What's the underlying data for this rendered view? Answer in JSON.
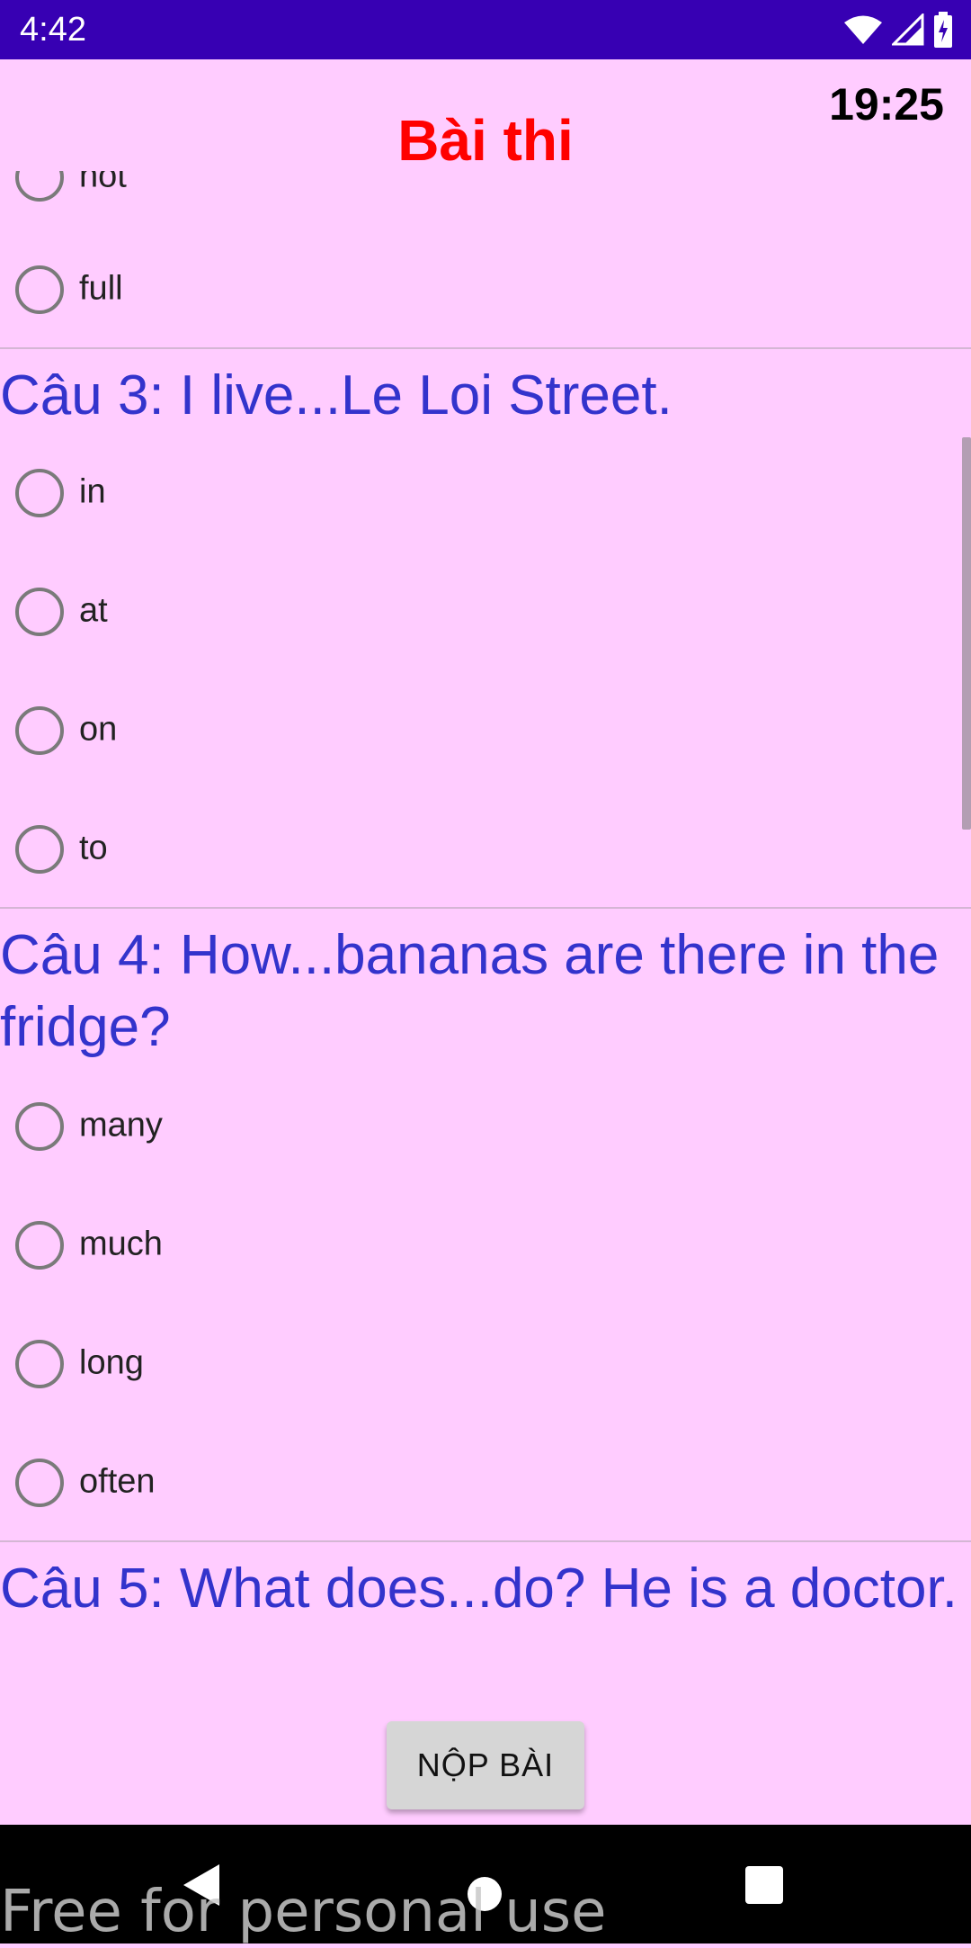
{
  "status_bar": {
    "time": "4:42"
  },
  "header": {
    "timer": "19:25",
    "title": "Bài thi"
  },
  "questions": [
    {
      "options": [
        "not",
        "full"
      ]
    },
    {
      "text": "Câu 3: I live...Le Loi Street.",
      "options": [
        "in",
        "at",
        "on",
        "to"
      ]
    },
    {
      "text": "Câu 4: How...bananas are there in the fridge?",
      "options": [
        "many",
        "much",
        "long",
        "often"
      ]
    },
    {
      "text": "Câu 5: What does...do? He is a doctor."
    }
  ],
  "submit_label": "NỘP BÀI",
  "watermark": "Free for personal use",
  "colors": {
    "status_bar": "#3700b3",
    "background": "#ffccff",
    "title": "#ff0000",
    "question": "#3333cc"
  }
}
